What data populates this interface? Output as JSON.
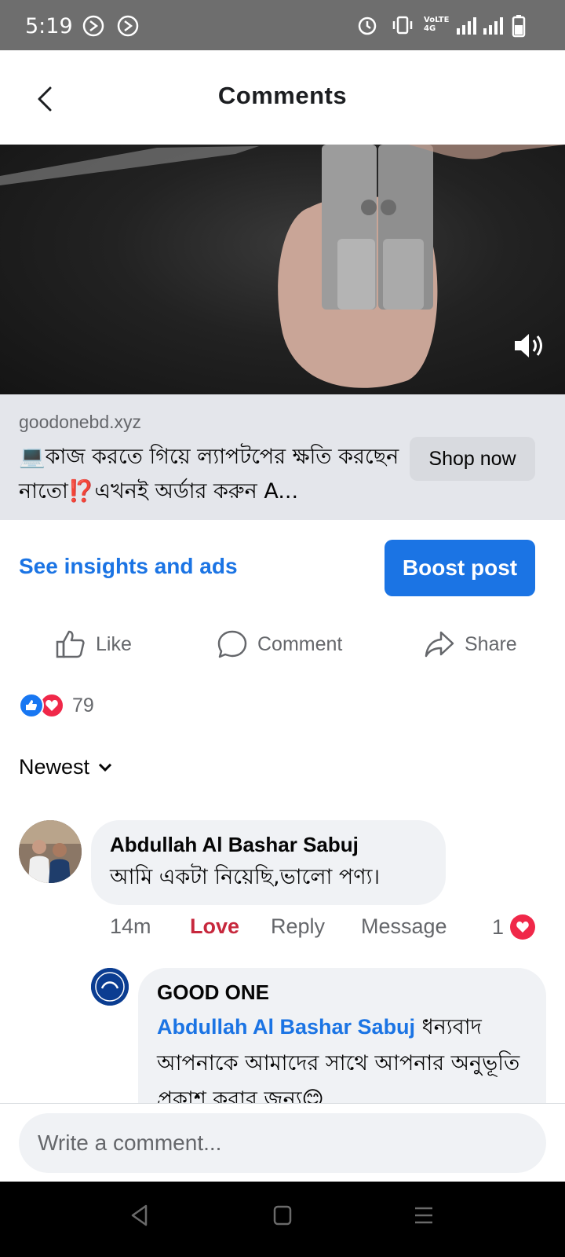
{
  "status_bar": {
    "time": "5:19",
    "network_label": "VoLTE 4G"
  },
  "header": {
    "title": "Comments"
  },
  "video": {
    "sound_icon": "speaker-icon"
  },
  "link_preview": {
    "domain": "goodonebd.xyz",
    "headline": "💻কাজ করতে গিয়ে ল্যাপটপের ক্ষতি করছেন নাতো⁉️এখনই অর্ডার করুন A...",
    "shop_button": "Shop now"
  },
  "insights": {
    "link_label": "See insights and ads",
    "boost_label": "Boost post"
  },
  "actions": {
    "like": "Like",
    "comment": "Comment",
    "share": "Share"
  },
  "reactions": {
    "count": "79"
  },
  "sort": {
    "label": "Newest"
  },
  "comments": [
    {
      "author": "Abdullah Al Bashar Sabuj",
      "text": "আমি একটা নিয়েছি,ভালো পণ্য।",
      "time": "14m",
      "reaction_label": "Love",
      "reply_label": "Reply",
      "message_label": "Message",
      "reaction_count": "1"
    },
    {
      "author": "GOOD ONE",
      "mention": "Abdullah Al Bashar Sabuj",
      "text": " ধন্যবাদ আপনাকে আমাদের সাথে আপনার অনুভূতি প্রকাশ করার জন্য😊"
    }
  ],
  "composer": {
    "placeholder": "Write a comment..."
  },
  "colors": {
    "accent": "#1b74e4",
    "love": "#c7283d",
    "status_bar": "#6e6e6e"
  }
}
